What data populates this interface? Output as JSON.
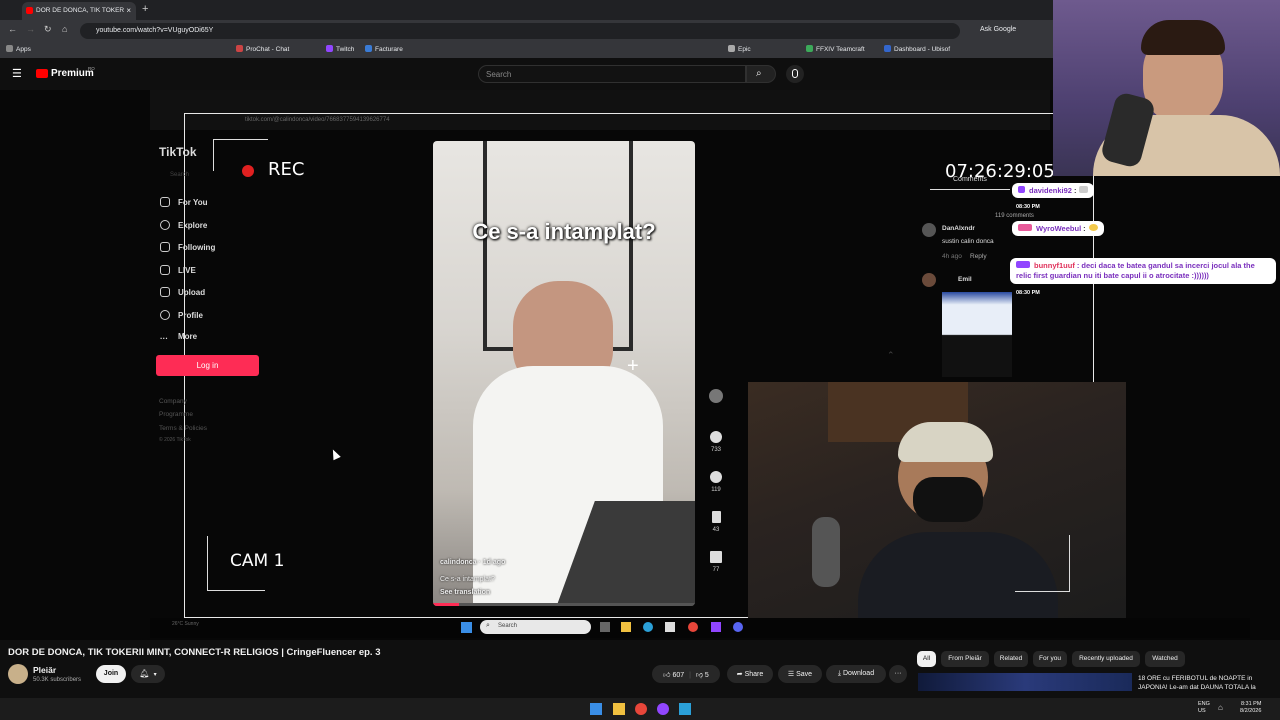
{
  "browser": {
    "tab_title": "DOR DE DONCA, TIK TOKER",
    "url": "youtube.com/watch?v=VUguyODi65Y",
    "ask_google": "Ask Google",
    "bookmarks": [
      "Apps",
      "ProChat - Chat",
      "Twitch",
      "Facturare",
      "Epic",
      "FFXIV Teamcraft",
      "Dashboard - Ubisof"
    ]
  },
  "youtube": {
    "logo_text": "Premium",
    "logo_badge": "RO",
    "search_placeholder": "Search"
  },
  "stream_overlay": {
    "rec_label": "REC",
    "cam_label": "CAM 1",
    "clock": "07:26:29:05"
  },
  "inner_browser": {
    "url": "tiktok.com/@calindonca/video/7668377594139626774"
  },
  "tiktok": {
    "logo": "TikTok",
    "search_placeholder": "Search",
    "nav": [
      "For You",
      "Explore",
      "Following",
      "LIVE",
      "Upload",
      "Profile",
      "More"
    ],
    "login": "Log in",
    "footer": [
      "Company",
      "Programme",
      "Terms & Policies",
      "© 2026 TikTok"
    ],
    "overlay_text": "Ce s-a intamplat?",
    "author": "calindonca · 1d ago",
    "caption": "Ce s-a intamplat?",
    "see_translation": "See translation",
    "likes": "733",
    "comments": "119",
    "saves": "43",
    "shares": "77",
    "comments_header": "Comments",
    "comments_count": "119 comments",
    "comment_user": "DanAlxndr",
    "comment_text": "sustin calin donca",
    "comment_time": "4h ago",
    "comment_reply": "Reply",
    "comment_user2": "Emil"
  },
  "chat": [
    {
      "user": "davidenki92",
      "text": ":",
      "time": "08:30 PM"
    },
    {
      "user": "WyroWeebul",
      "text": ":",
      "time": ""
    },
    {
      "user": "bunnyf1uuf",
      "text": ": deci daca te batea gandul sa incerci jocul ala the relic first guardian nu iti bate capul ii o atrocitate :))))))",
      "time": "08:30 PM"
    }
  ],
  "video_info": {
    "title": "DOR DE DONCA, TIK TOKERII MINT, CONNECT-R RELIGIOS | CringeFluencer ep. 3",
    "channel": "Pleiăr",
    "subscribers": "50.3K subscribers",
    "join": "Join",
    "likes": "607",
    "dislikes": "5",
    "share": "Share",
    "save": "Save",
    "download": "Download"
  },
  "chips": [
    "All",
    "From Pleiăr",
    "Related",
    "For you",
    "Recently uploaded",
    "Watched"
  ],
  "recommended": {
    "title": "18 ORE cu FERIBOTUL de NOAPTE in JAPONIA! Le-am dat DAUNA TOTALA la"
  },
  "inner_taskbar": {
    "search": "Search",
    "weather": "26°C Sunny"
  },
  "taskbar": {
    "lang": "ENG US",
    "time": "8:31 PM",
    "date": "8/2/2026"
  },
  "colors": {
    "youtube_red": "#ff0000",
    "tiktok_pink": "#fe2c55",
    "chat_purple": "#7a2fbd"
  }
}
